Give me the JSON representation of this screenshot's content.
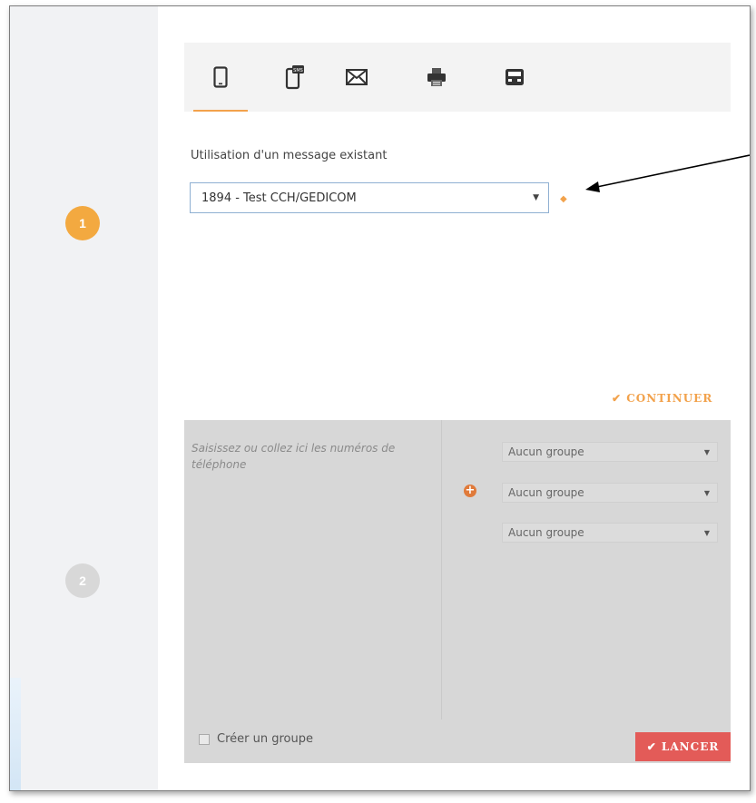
{
  "tabs": [
    {
      "icon": "mobile-phone-icon"
    },
    {
      "icon": "sms-phone-icon",
      "badge": "SMS"
    },
    {
      "icon": "envelope-icon"
    },
    {
      "icon": "fax-icon"
    },
    {
      "icon": "voice-server-icon"
    }
  ],
  "steps": {
    "step1": "1",
    "step2": "2"
  },
  "existing_message": {
    "label": "Utilisation d'un message existant",
    "selected": "1894 - Test CCH/GEDICOM",
    "caret": "▼",
    "arrow_marker": "◆"
  },
  "continue_label": "✔ CONTINUER",
  "recipients": {
    "placeholder": "Saisissez ou collez ici les numéros de téléphone",
    "plus": "+",
    "groups": [
      "Aucun groupe",
      "Aucun groupe",
      "Aucun groupe"
    ],
    "caret": "▼",
    "create_group_label": "Créer un groupe",
    "launch_label": "✔ LANCER"
  },
  "colors": {
    "accent": "#f2a24c",
    "launch": "#e35b58",
    "step_active": "#f3a940",
    "step_inactive": "#d8d8d8"
  }
}
